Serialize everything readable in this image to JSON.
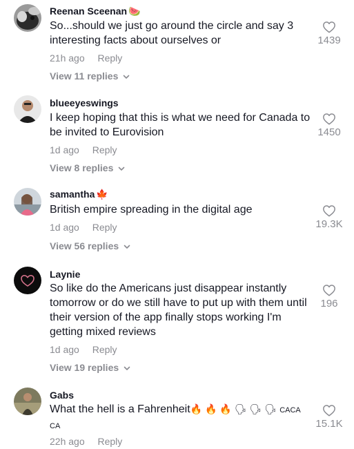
{
  "comments": [
    {
      "username": "Reenan Sceenan",
      "flair": "🍉",
      "text": "So...should we just go around the circle and say 3 interesting facts about ourselves or",
      "time": "21h ago",
      "reply_label": "Reply",
      "replies_label": "View 11 replies",
      "likes": "1439"
    },
    {
      "username": "blueeyeswings",
      "flair": "",
      "text": "I keep hoping that this is what we need for Canada to be invited to Eurovision",
      "time": "1d ago",
      "reply_label": "Reply",
      "replies_label": "View 8 replies",
      "likes": "1450"
    },
    {
      "username": "samantha",
      "flair": "🍁",
      "text": "British empire spreading in the digital age",
      "time": "1d ago",
      "reply_label": "Reply",
      "replies_label": "View 56 replies",
      "likes": "19.3K"
    },
    {
      "username": "Laynie",
      "flair": "",
      "text": "So like do the Americans just disappear instantly tomorrow or do we still have to put up with them until their version of the app finally stops working I'm getting mixed reviews",
      "time": "1d ago",
      "reply_label": "Reply",
      "replies_label": "View 19 replies",
      "likes": "196"
    },
    {
      "username": "Gabs",
      "flair": "",
      "text": "What the hell is a Fahrenheit",
      "text_emojis": "🔥 🔥 🔥 🗣 🗣 🗣",
      "text_suffix": "CACA CA",
      "time": "22h ago",
      "reply_label": "Reply",
      "likes": "15.1K"
    }
  ],
  "colors": {
    "primary_text": "#161823",
    "secondary_text": "#8a8b91",
    "heart_outline": "#8a8b91",
    "background": "#ffffff"
  }
}
